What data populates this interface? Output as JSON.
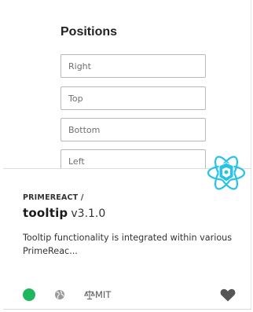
{
  "preview": {
    "title": "Positions",
    "inputs": [
      {
        "placeholder": "Right"
      },
      {
        "placeholder": "Top"
      },
      {
        "placeholder": "Bottom"
      },
      {
        "placeholder": "Left"
      }
    ]
  },
  "package": {
    "scope": "PRIMEREACT /",
    "name": "tooltip",
    "version": "v3.1.0",
    "description": "Tooltip functionality is integrated within various PrimeReac..."
  },
  "footer": {
    "status_color": "#1fb75e",
    "globe_icon": "globe-icon",
    "license_icon": "scale-icon",
    "license": "MIT",
    "favorite_icon": "heart-icon"
  },
  "colors": {
    "logo_accent": "#26c2e8"
  }
}
